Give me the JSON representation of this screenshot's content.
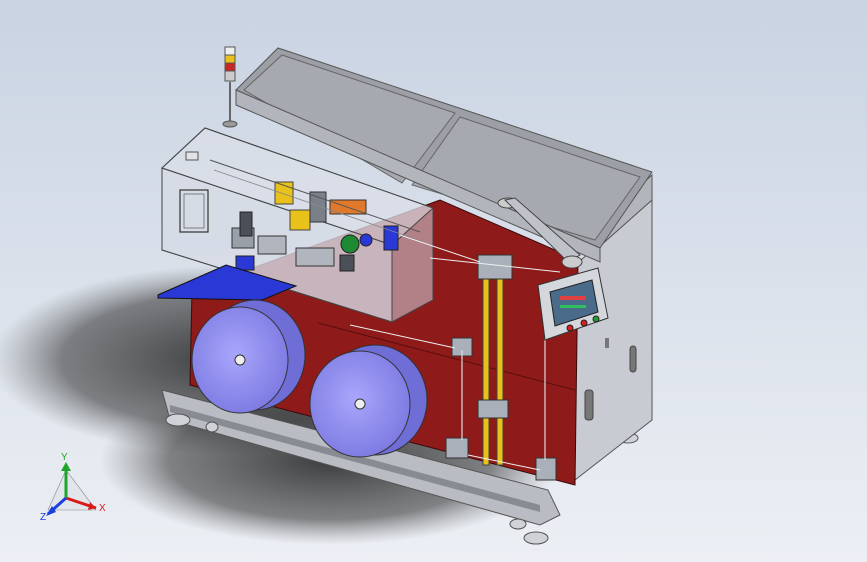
{
  "viewport": {
    "background_top": "#c9d3e2",
    "background_bottom": "#eceff4",
    "shadow_color": "#2a2a2a"
  },
  "machine": {
    "body_color": "#8e1a1a",
    "frame_color": "#b9bcc2",
    "top_color": "#9c9fa5",
    "glass_color": "#cfd6e2",
    "reel_color": "#8f8df0",
    "tray_color": "#2a38d6",
    "accent_yellow": "#e8c21a",
    "screen_color": "#4b6b8a"
  },
  "triad": {
    "x_label": "X",
    "y_label": "Y",
    "z_label": "Z",
    "x_color": "#d61b1b",
    "y_color": "#1ea62b",
    "z_color": "#1b3ee0"
  }
}
